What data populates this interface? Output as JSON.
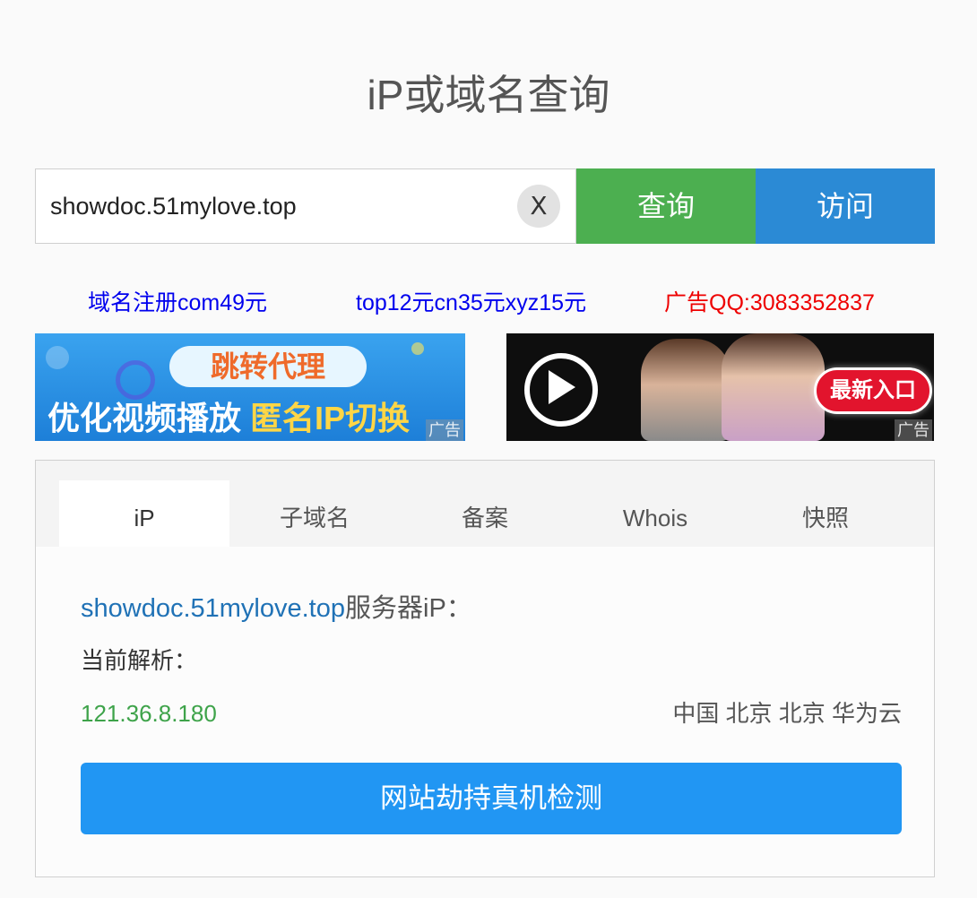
{
  "header": {
    "title": "iP或域名查询"
  },
  "search": {
    "value": "showdoc.51mylove.top",
    "clear_label": "X",
    "query_label": "查询",
    "visit_label": "访问"
  },
  "ad_links": [
    {
      "text": "域名注册com49元",
      "color": "#0000ee"
    },
    {
      "text": "top12元cn35元xyz15元",
      "color": "#0000ee"
    },
    {
      "text": "广告QQ:3083352837",
      "color": "#ee0000"
    }
  ],
  "banners": {
    "left": {
      "line1": "跳转代理",
      "line2_a": "优化视频播放",
      "line2_b": "匿名IP切换",
      "ad_tag": "广告"
    },
    "right": {
      "cta": "最新入口",
      "ad_tag": "广告"
    }
  },
  "tabs": [
    {
      "label": "iP",
      "active": true
    },
    {
      "label": "子域名",
      "active": false
    },
    {
      "label": "备案",
      "active": false
    },
    {
      "label": "Whois",
      "active": false
    },
    {
      "label": "快照",
      "active": false
    }
  ],
  "result": {
    "domain": "showdoc.51mylove.top",
    "heading_suffix": "服务器iP：",
    "resolve_label": "当前解析：",
    "ip": "121.36.8.180",
    "location": "中国 北京 北京 华为云",
    "detect_button": "网站劫持真机检测"
  },
  "colors": {
    "query_button": "#4caf50",
    "visit_button": "#2b8ad5",
    "ip_green": "#3ea34a",
    "domain_blue": "#2072b6",
    "detect_button": "#2196f3"
  }
}
